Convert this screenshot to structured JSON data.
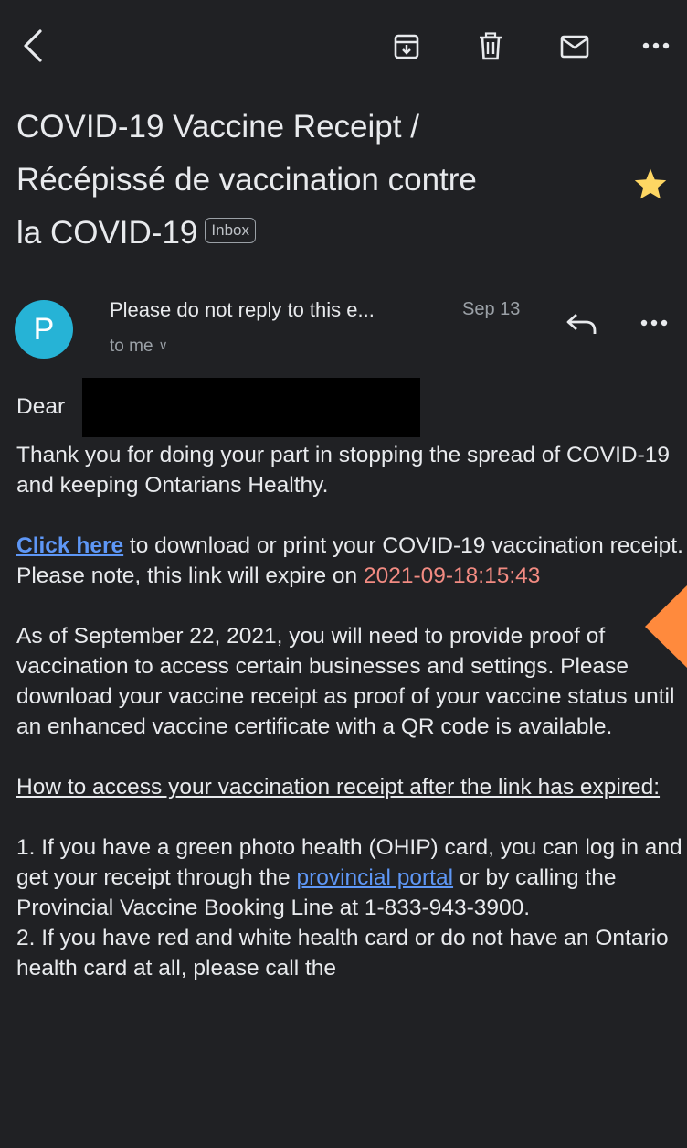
{
  "toolbar": {
    "back_icon": "back-arrow-icon",
    "archive_icon": "archive-icon",
    "delete_icon": "trash-icon",
    "mark_unread_icon": "envelope-icon",
    "more_icon": "more-horizontal-icon"
  },
  "email": {
    "subject_line1": "COVID-19 Vaccine Receipt /",
    "subject_line2": "Récépissé de vaccination contre",
    "subject_line3": "la COVID-19",
    "label": "Inbox",
    "starred": true,
    "sender_initial": "P",
    "sender_name": "Please do not reply to this e...",
    "date": "Sep 13",
    "recipient": "to me",
    "body": {
      "greeting": "Dear",
      "para1": "Thank you for doing your part in stopping the spread of COVID-19 and keeping Ontarians Healthy.",
      "link1": "Click here",
      "para2_rest": " to download or print your COVID-19 vaccination receipt. Please note, this link will expire on ",
      "expire_date": "2021-09-18:15:43",
      "para3": "As of September 22, 2021, you will need to provide proof of vaccination to access certain businesses and settings. Please download your vaccine receipt as proof of your vaccine status until an enhanced vaccine certificate with a QR code is available.",
      "heading": "How to access your vaccination receipt after the link has expired:",
      "item1_a": "1. If you have a green photo health (OHIP) card, you can log in and get your receipt through the ",
      "item1_link": "provincial portal",
      "item1_b": " or by calling the Provincial Vaccine Booking Line at 1-833-943-3900.",
      "item2": "2. If you have red and white health card or do not have an Ontario health card at all, please call the"
    }
  },
  "colors": {
    "background": "#202124",
    "avatar": "#26b3d6",
    "star": "#fdd663",
    "link": "#5e97f6",
    "expire": "#f28b82",
    "overlay_arrow": "#ff8a3d"
  }
}
